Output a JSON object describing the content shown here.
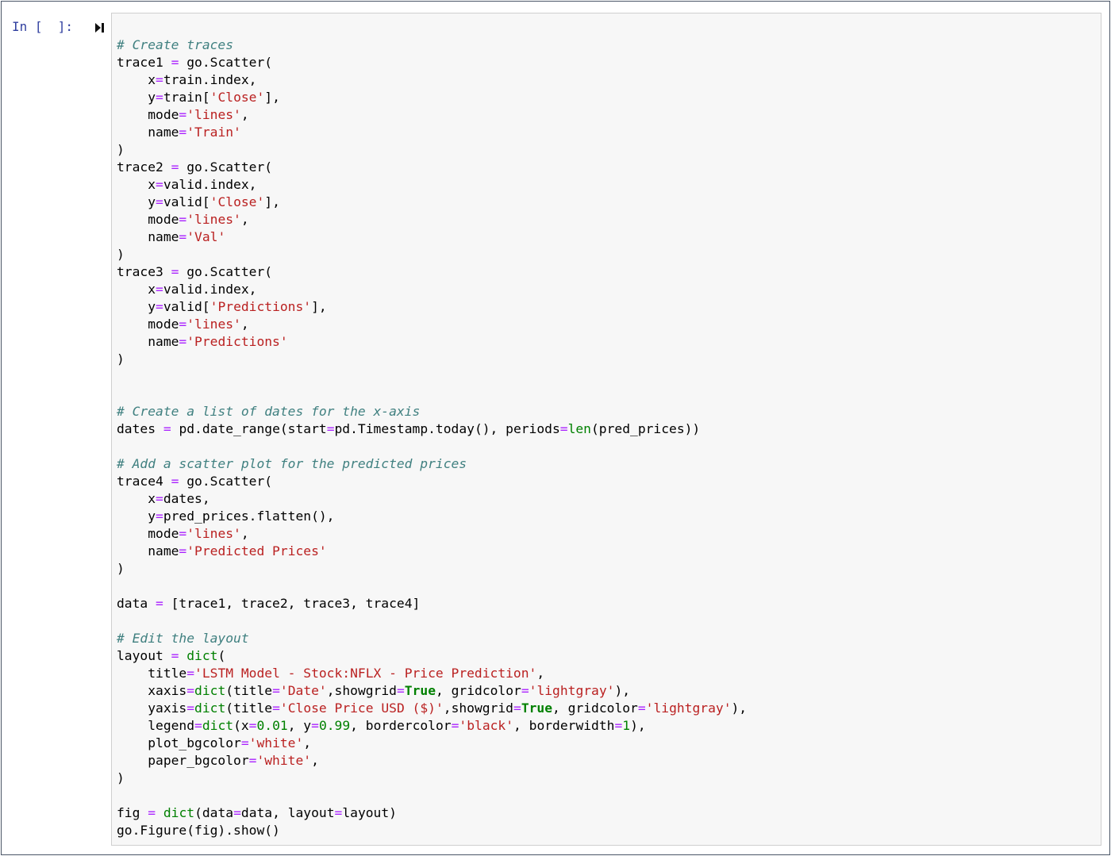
{
  "cell": {
    "prompt": "In [  ]:",
    "run_icon": "run-cell-icon",
    "code_lines": [
      [
        [
          "comment",
          "# Create traces"
        ]
      ],
      [
        [
          "text",
          "trace1 "
        ],
        [
          "operator",
          "="
        ],
        [
          "text",
          " go.Scatter("
        ]
      ],
      [
        [
          "text",
          "    x"
        ],
        [
          "operator",
          "="
        ],
        [
          "text",
          "train.index,"
        ]
      ],
      [
        [
          "text",
          "    y"
        ],
        [
          "operator",
          "="
        ],
        [
          "text",
          "train["
        ],
        [
          "string",
          "'Close'"
        ],
        [
          "text",
          "],"
        ]
      ],
      [
        [
          "text",
          "    mode"
        ],
        [
          "operator",
          "="
        ],
        [
          "string",
          "'lines'"
        ],
        [
          "text",
          ","
        ]
      ],
      [
        [
          "text",
          "    name"
        ],
        [
          "operator",
          "="
        ],
        [
          "string",
          "'Train'"
        ]
      ],
      [
        [
          "text",
          ")"
        ]
      ],
      [
        [
          "text",
          "trace2 "
        ],
        [
          "operator",
          "="
        ],
        [
          "text",
          " go.Scatter("
        ]
      ],
      [
        [
          "text",
          "    x"
        ],
        [
          "operator",
          "="
        ],
        [
          "text",
          "valid.index,"
        ]
      ],
      [
        [
          "text",
          "    y"
        ],
        [
          "operator",
          "="
        ],
        [
          "text",
          "valid["
        ],
        [
          "string",
          "'Close'"
        ],
        [
          "text",
          "],"
        ]
      ],
      [
        [
          "text",
          "    mode"
        ],
        [
          "operator",
          "="
        ],
        [
          "string",
          "'lines'"
        ],
        [
          "text",
          ","
        ]
      ],
      [
        [
          "text",
          "    name"
        ],
        [
          "operator",
          "="
        ],
        [
          "string",
          "'Val'"
        ]
      ],
      [
        [
          "text",
          ")"
        ]
      ],
      [
        [
          "text",
          "trace3 "
        ],
        [
          "operator",
          "="
        ],
        [
          "text",
          " go.Scatter("
        ]
      ],
      [
        [
          "text",
          "    x"
        ],
        [
          "operator",
          "="
        ],
        [
          "text",
          "valid.index,"
        ]
      ],
      [
        [
          "text",
          "    y"
        ],
        [
          "operator",
          "="
        ],
        [
          "text",
          "valid["
        ],
        [
          "string",
          "'Predictions'"
        ],
        [
          "text",
          "],"
        ]
      ],
      [
        [
          "text",
          "    mode"
        ],
        [
          "operator",
          "="
        ],
        [
          "string",
          "'lines'"
        ],
        [
          "text",
          ","
        ]
      ],
      [
        [
          "text",
          "    name"
        ],
        [
          "operator",
          "="
        ],
        [
          "string",
          "'Predictions'"
        ]
      ],
      [
        [
          "text",
          ")"
        ]
      ],
      [],
      [],
      [
        [
          "comment",
          "# Create a list of dates for the x-axis"
        ]
      ],
      [
        [
          "text",
          "dates "
        ],
        [
          "operator",
          "="
        ],
        [
          "text",
          " pd.date_range(start"
        ],
        [
          "operator",
          "="
        ],
        [
          "text",
          "pd.Timestamp.today(), periods"
        ],
        [
          "operator",
          "="
        ],
        [
          "builtin",
          "len"
        ],
        [
          "text",
          "(pred_prices))"
        ]
      ],
      [],
      [
        [
          "comment",
          "# Add a scatter plot for the predicted prices"
        ]
      ],
      [
        [
          "text",
          "trace4 "
        ],
        [
          "operator",
          "="
        ],
        [
          "text",
          " go.Scatter("
        ]
      ],
      [
        [
          "text",
          "    x"
        ],
        [
          "operator",
          "="
        ],
        [
          "text",
          "dates,"
        ]
      ],
      [
        [
          "text",
          "    y"
        ],
        [
          "operator",
          "="
        ],
        [
          "text",
          "pred_prices.flatten(),"
        ]
      ],
      [
        [
          "text",
          "    mode"
        ],
        [
          "operator",
          "="
        ],
        [
          "string",
          "'lines'"
        ],
        [
          "text",
          ","
        ]
      ],
      [
        [
          "text",
          "    name"
        ],
        [
          "operator",
          "="
        ],
        [
          "string",
          "'Predicted Prices'"
        ]
      ],
      [
        [
          "text",
          ")"
        ]
      ],
      [],
      [
        [
          "text",
          "data "
        ],
        [
          "operator",
          "="
        ],
        [
          "text",
          " [trace1, trace2, trace3, trace4]"
        ]
      ],
      [],
      [
        [
          "comment",
          "# Edit the layout"
        ]
      ],
      [
        [
          "text",
          "layout "
        ],
        [
          "operator",
          "="
        ],
        [
          "text",
          " "
        ],
        [
          "builtin",
          "dict"
        ],
        [
          "text",
          "("
        ]
      ],
      [
        [
          "text",
          "    title"
        ],
        [
          "operator",
          "="
        ],
        [
          "string",
          "'LSTM Model - Stock:NFLX - Price Prediction'"
        ],
        [
          "text",
          ","
        ]
      ],
      [
        [
          "text",
          "    xaxis"
        ],
        [
          "operator",
          "="
        ],
        [
          "builtin",
          "dict"
        ],
        [
          "text",
          "(title"
        ],
        [
          "operator",
          "="
        ],
        [
          "string",
          "'Date'"
        ],
        [
          "text",
          ",showgrid"
        ],
        [
          "operator",
          "="
        ],
        [
          "keyword",
          "True"
        ],
        [
          "text",
          ", gridcolor"
        ],
        [
          "operator",
          "="
        ],
        [
          "string",
          "'lightgray'"
        ],
        [
          "text",
          "),"
        ]
      ],
      [
        [
          "text",
          "    yaxis"
        ],
        [
          "operator",
          "="
        ],
        [
          "builtin",
          "dict"
        ],
        [
          "text",
          "(title"
        ],
        [
          "operator",
          "="
        ],
        [
          "string",
          "'Close Price USD ($)'"
        ],
        [
          "text",
          ",showgrid"
        ],
        [
          "operator",
          "="
        ],
        [
          "keyword",
          "True"
        ],
        [
          "text",
          ", gridcolor"
        ],
        [
          "operator",
          "="
        ],
        [
          "string",
          "'lightgray'"
        ],
        [
          "text",
          "),"
        ]
      ],
      [
        [
          "text",
          "    legend"
        ],
        [
          "operator",
          "="
        ],
        [
          "builtin",
          "dict"
        ],
        [
          "text",
          "(x"
        ],
        [
          "operator",
          "="
        ],
        [
          "number",
          "0.01"
        ],
        [
          "text",
          ", y"
        ],
        [
          "operator",
          "="
        ],
        [
          "number",
          "0.99"
        ],
        [
          "text",
          ", bordercolor"
        ],
        [
          "operator",
          "="
        ],
        [
          "string",
          "'black'"
        ],
        [
          "text",
          ", borderwidth"
        ],
        [
          "operator",
          "="
        ],
        [
          "number",
          "1"
        ],
        [
          "text",
          "),"
        ]
      ],
      [
        [
          "text",
          "    plot_bgcolor"
        ],
        [
          "operator",
          "="
        ],
        [
          "string",
          "'white'"
        ],
        [
          "text",
          ","
        ]
      ],
      [
        [
          "text",
          "    paper_bgcolor"
        ],
        [
          "operator",
          "="
        ],
        [
          "string",
          "'white'"
        ],
        [
          "text",
          ","
        ]
      ],
      [
        [
          "text",
          ")"
        ]
      ],
      [],
      [
        [
          "text",
          "fig "
        ],
        [
          "operator",
          "="
        ],
        [
          "text",
          " "
        ],
        [
          "builtin",
          "dict"
        ],
        [
          "text",
          "(data"
        ],
        [
          "operator",
          "="
        ],
        [
          "text",
          "data, layout"
        ],
        [
          "operator",
          "="
        ],
        [
          "text",
          "layout)"
        ]
      ],
      [
        [
          "text",
          "go.Figure(fig).show()"
        ]
      ]
    ]
  },
  "colors": {
    "prompt": "#303f9f",
    "comment": "#408080",
    "string": "#ba2121",
    "operator": "#aa22ff",
    "keyword": "#008000",
    "cell_background": "#f7f7f7",
    "cell_border": "#cfcfcf"
  }
}
